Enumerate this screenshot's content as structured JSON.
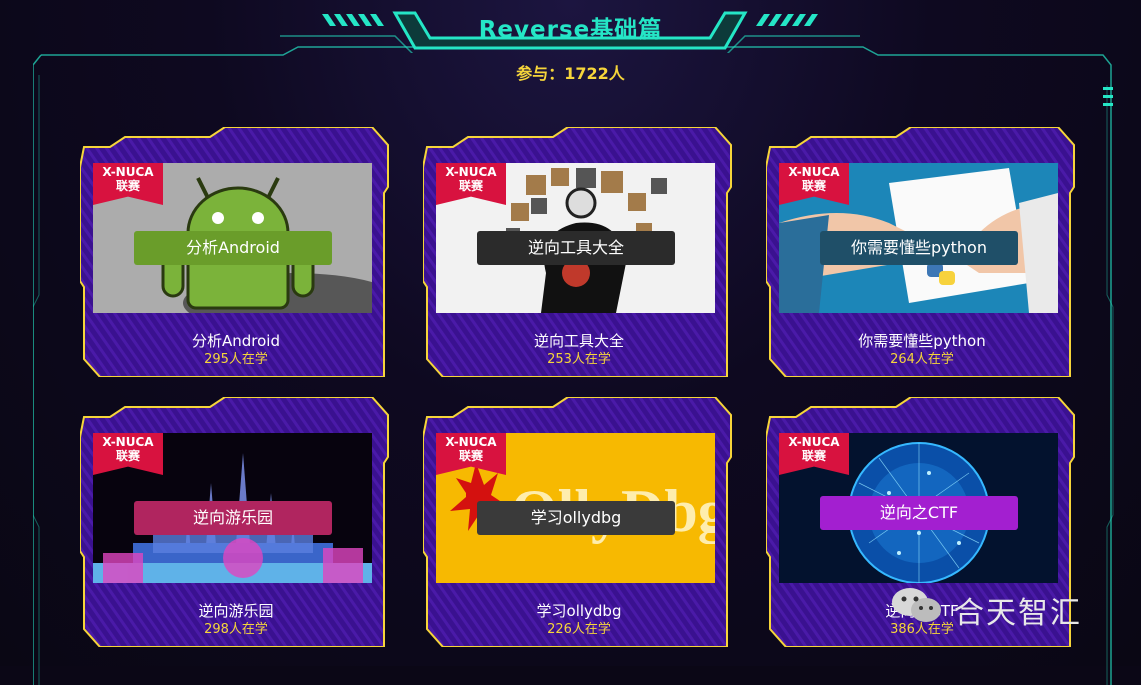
{
  "header": {
    "title": "Reverse基础篇",
    "participants": "参与：1722人"
  },
  "badge_text": {
    "line1": "X-NUCA",
    "line2": "联赛"
  },
  "courses": [
    {
      "name": "分析Android",
      "count": "295人在学",
      "overlay": "分析Android",
      "overlay_color": "#6a9d2a",
      "thumb": "android"
    },
    {
      "name": "逆向工具大全",
      "count": "253人在学",
      "overlay": "逆向工具大全",
      "overlay_color": "#2b2b2b",
      "thumb": "tools"
    },
    {
      "name": "你需要懂些python",
      "count": "264人在学",
      "overlay": "你需要懂些python",
      "overlay_color": "#1f4f68",
      "thumb": "python"
    },
    {
      "name": "逆向游乐园",
      "count": "298人在学",
      "overlay": "逆向游乐园",
      "overlay_color": "#b0255f",
      "thumb": "castle"
    },
    {
      "name": "学习ollydbg",
      "count": "226人在学",
      "overlay": "学习ollydbg",
      "overlay_color": "#3a3a3a",
      "thumb": "ollydbg"
    },
    {
      "name": "逆向之CTF",
      "count": "386人在学",
      "overlay": "逆向之CTF",
      "overlay_color": "#a31fd0",
      "thumb": "globe"
    }
  ],
  "ollydbg_logo": "OllyDbg",
  "watermark": {
    "text": "合天智汇"
  },
  "colors": {
    "accent": "#25e6c6",
    "card_bg": "#3a1190",
    "card_border": "#f6d53a",
    "badge": "#d8123f"
  }
}
